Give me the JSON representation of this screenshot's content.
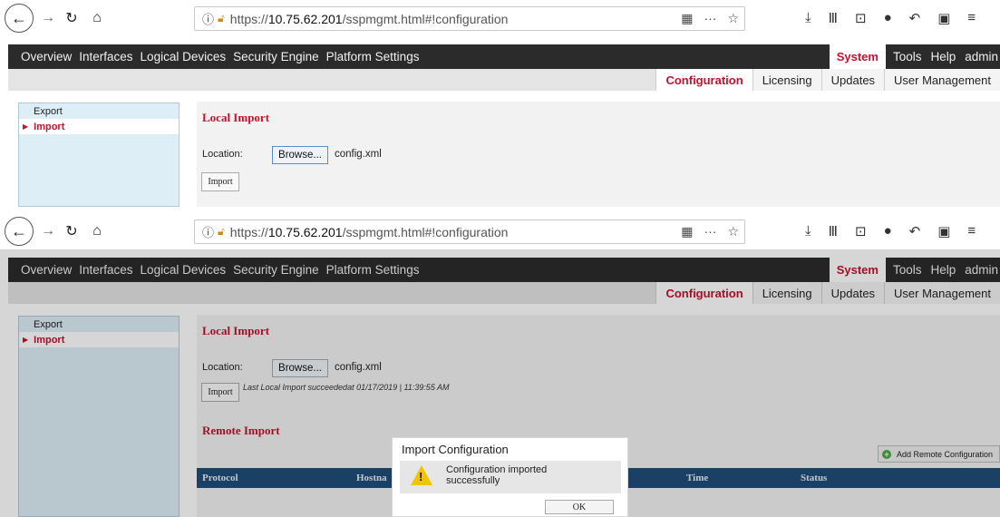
{
  "browser": {
    "back_icon": "←",
    "forward_icon": "→",
    "reload_icon": "↻",
    "home_icon": "⌂",
    "url_prefix": "https://",
    "url_host": "10.75.62.201",
    "url_path": "/sspmgmt.html#!configuration",
    "more_icon": "···",
    "star_icon": "☆",
    "qr_icon": "▦"
  },
  "nav": {
    "items": [
      "Overview",
      "Interfaces",
      "Logical Devices",
      "Security Engine",
      "Platform Settings"
    ],
    "system": "System",
    "tools": "Tools",
    "help": "Help",
    "user": "admin"
  },
  "subtabs": [
    "Configuration",
    "Licensing",
    "Updates",
    "User Management"
  ],
  "sidebar": {
    "export": "Export",
    "import": "Import"
  },
  "local_import": {
    "title": "Local Import",
    "location_label": "Location:",
    "browse": "Browse...",
    "file": "config.xml",
    "import_button": "Import",
    "last_import": "Last Local Import succeededat 01/17/2019 | 11:39:55 AM"
  },
  "remote_import": {
    "title": "Remote Import",
    "add_button": "Add Remote Configuration",
    "columns": [
      "Protocol",
      "Hostna",
      "Time",
      "Status"
    ]
  },
  "dialog": {
    "title": "Import Configuration",
    "message": "Configuration imported successfully",
    "ok": "OK"
  },
  "colors": {
    "accent": "#c8102e",
    "navbar": "#2b2b2b",
    "table_header": "#1f4e79"
  }
}
